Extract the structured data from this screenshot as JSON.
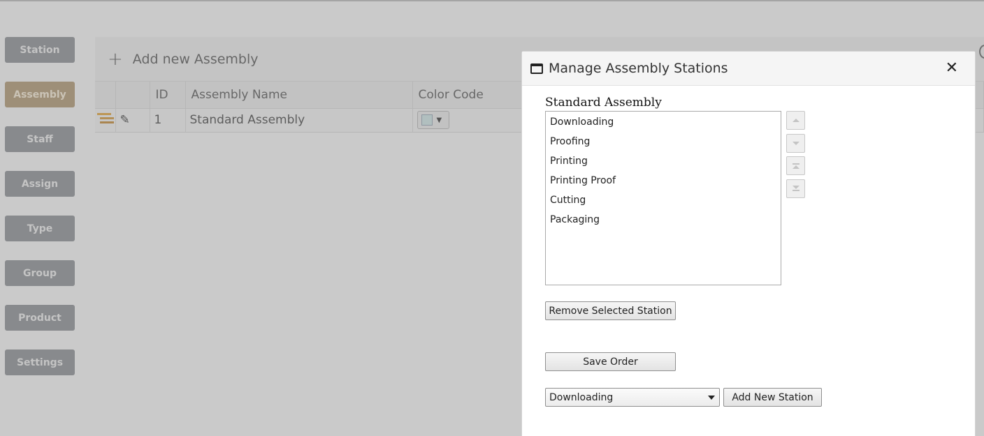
{
  "sidebar": {
    "items": [
      {
        "label": "Station"
      },
      {
        "label": "Assembly"
      },
      {
        "label": "Staff"
      },
      {
        "label": "Assign"
      },
      {
        "label": "Type"
      },
      {
        "label": "Group"
      },
      {
        "label": "Product"
      },
      {
        "label": "Settings"
      }
    ],
    "active": "Assembly"
  },
  "main": {
    "add_label": "Add new Assembly",
    "add_icon": "plus-icon",
    "table": {
      "columns": [
        "",
        "",
        "ID",
        "Assembly Name",
        "Color Code"
      ],
      "rows": [
        {
          "id": "1",
          "name": "Standard Assembly",
          "color": "#d4ecec"
        }
      ]
    }
  },
  "dialog": {
    "title": "Manage Assembly Stations",
    "assembly_name": "Standard Assembly",
    "stations": [
      "Downloading",
      "Proofing",
      "Printing",
      "Printing Proof",
      "Cutting",
      "Packaging"
    ],
    "order_buttons": [
      "move-up-icon",
      "move-down-icon",
      "move-top-icon",
      "move-bottom-icon"
    ],
    "remove_label": "Remove Selected Station",
    "save_label": "Save Order",
    "select_value": "Downloading",
    "add_label": "Add New Station"
  }
}
